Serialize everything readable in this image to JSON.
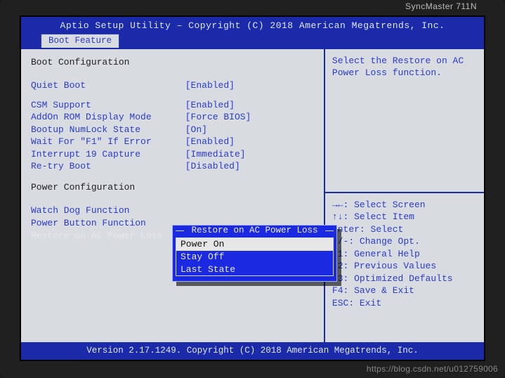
{
  "monitor_brand": "SyncMaster 711N",
  "header": "Aptio Setup Utility – Copyright (C) 2018 American Megatrends, Inc.",
  "tab": "Boot Feature",
  "sections": {
    "boot_title": "Boot Configuration",
    "power_title": "Power Configuration"
  },
  "rows": {
    "quiet_boot": {
      "label": "Quiet Boot",
      "value": "[Enabled]"
    },
    "csm_support": {
      "label": "CSM Support",
      "value": "[Enabled]"
    },
    "addon_rom": {
      "label": "AddOn ROM Display Mode",
      "value": "[Force BIOS]"
    },
    "numlock": {
      "label": "Bootup NumLock State",
      "value": "[On]"
    },
    "wait_f1": {
      "label": "Wait For \"F1\" If Error",
      "value": "[Enabled]"
    },
    "int19": {
      "label": "Interrupt 19 Capture",
      "value": "[Immediate]"
    },
    "retry": {
      "label": "Re-try Boot",
      "value": "[Disabled]"
    },
    "watchdog": {
      "label": "Watch Dog Function",
      "value": ""
    },
    "pwrbtn": {
      "label": "Power Button Function",
      "value": ""
    },
    "restore_ac": {
      "label": "Restore on AC Power Loss",
      "value": ""
    }
  },
  "popup": {
    "title": "Restore on AC Power Loss",
    "items": [
      "Power On",
      "Stay Off",
      "Last State"
    ],
    "selected_index": 0
  },
  "help_top": "Select the Restore on AC Power Loss function.",
  "help_bottom": [
    "→←: Select Screen",
    "↑↓: Select Item",
    "Enter: Select",
    "+/-: Change Opt.",
    "F1: General Help",
    "F2: Previous Values",
    "F3: Optimized Defaults",
    "F4: Save & Exit",
    "ESC: Exit"
  ],
  "footer": "Version 2.17.1249. Copyright (C) 2018 American Megatrends, Inc.",
  "watermark": "https://blog.csdn.net/u012759006"
}
